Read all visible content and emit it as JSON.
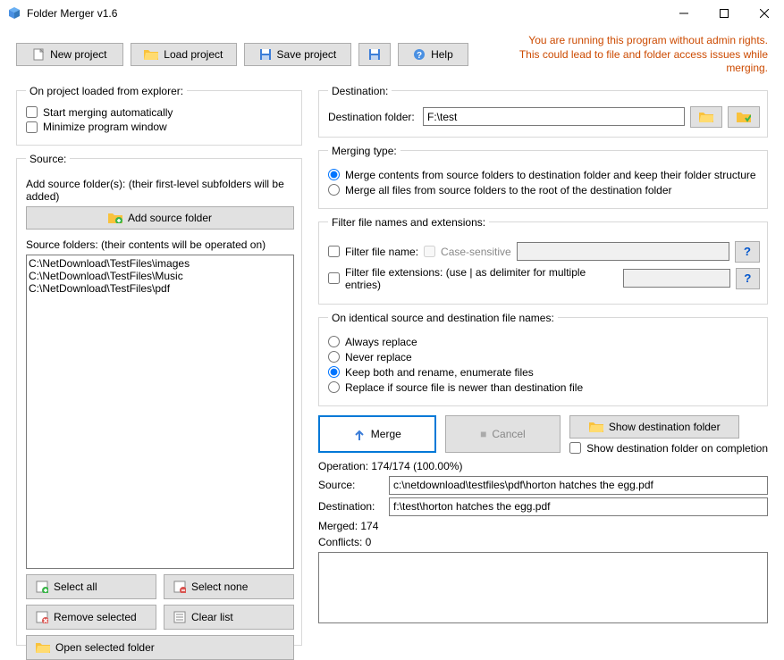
{
  "window": {
    "title": "Folder Merger v1.6"
  },
  "warning": {
    "line1": "You are running this program without admin rights.",
    "line2": "This could lead to file and folder access issues while merging."
  },
  "toolbar": {
    "new_project": "New project",
    "load_project": "Load project",
    "save_project": "Save project",
    "help": "Help"
  },
  "explorer": {
    "legend": "On project loaded from explorer:",
    "start_merging": "Start merging automatically",
    "minimize": "Minimize program window"
  },
  "source": {
    "legend": "Source:",
    "add_label": "Add source folder(s): (their first-level subfolders will be added)",
    "add_button": "Add source folder",
    "list_label": "Source folders: (their contents will be operated on)",
    "folders": [
      "C:\\NetDownload\\TestFiles\\images",
      "C:\\NetDownload\\TestFiles\\Music",
      "C:\\NetDownload\\TestFiles\\pdf"
    ],
    "select_all": "Select all",
    "select_none": "Select none",
    "remove_selected": "Remove selected",
    "clear_list": "Clear list",
    "open_selected": "Open selected folder"
  },
  "destination": {
    "legend": "Destination:",
    "label": "Destination folder:",
    "value": "F:\\test"
  },
  "merging": {
    "legend": "Merging type:",
    "opt1": "Merge contents from source folders to destination folder and keep their folder structure",
    "opt2": "Merge all files from source folders to the root of the destination folder"
  },
  "filter": {
    "legend": "Filter file names and extensions:",
    "name": "Filter file name:",
    "case_sensitive": "Case-sensitive",
    "ext": "Filter file extensions: (use | as delimiter for multiple entries)"
  },
  "identical": {
    "legend": "On identical source and destination file names:",
    "opt1": "Always replace",
    "opt2": "Never replace",
    "opt3": "Keep both and rename, enumerate files",
    "opt4": "Replace if source file is newer than destination file"
  },
  "actions": {
    "merge": "Merge",
    "cancel": "Cancel",
    "show_dest": "Show destination folder",
    "show_on_complete": "Show destination folder on completion"
  },
  "status": {
    "operation": "Operation: 174/174 (100.00%)",
    "source_label": "Source:",
    "source_value": "c:\\netdownload\\testfiles\\pdf\\horton hatches the egg.pdf",
    "dest_label": "Destination:",
    "dest_value": "f:\\test\\horton hatches the egg.pdf",
    "merged": "Merged: 174",
    "conflicts": "Conflicts: 0"
  }
}
